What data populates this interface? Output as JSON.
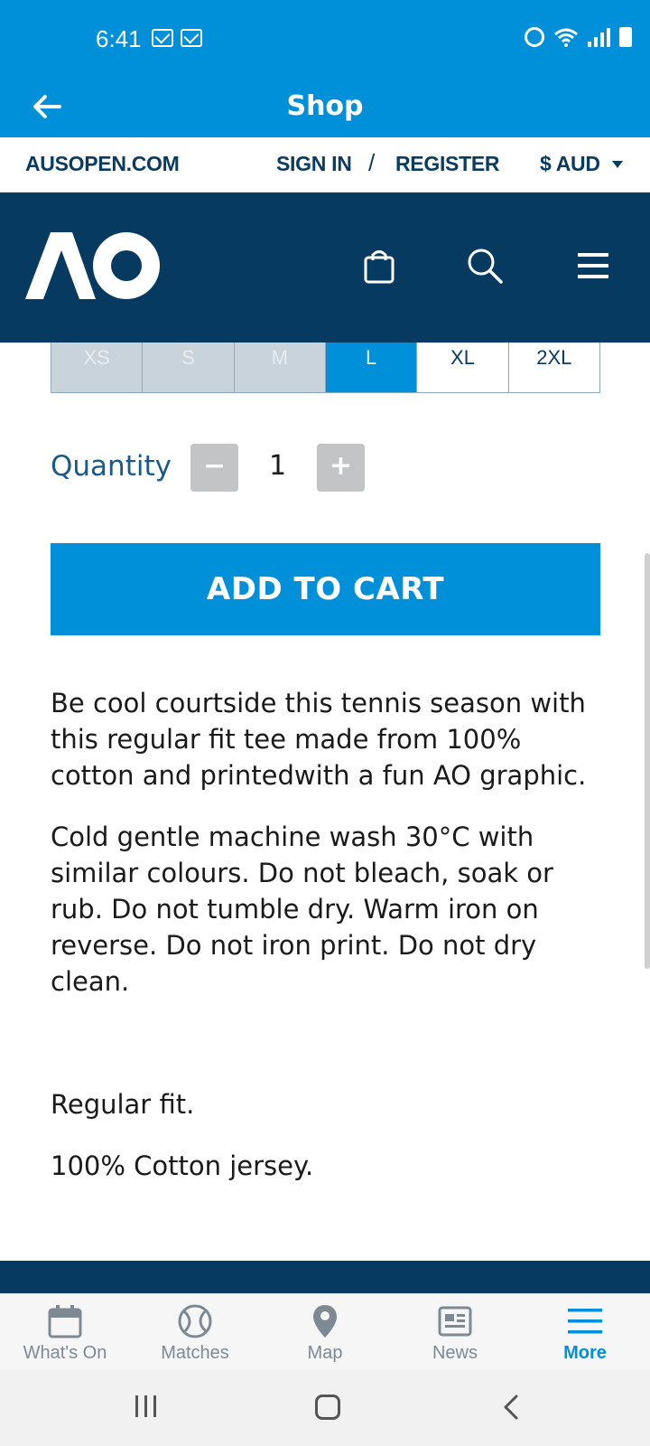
{
  "status_bar": {
    "time": "6:41"
  },
  "header": {
    "title": "Shop"
  },
  "top_links": {
    "site": "AUSOPEN.COM",
    "sign_in": "SIGN IN",
    "divider": "/",
    "register": "REGISTER",
    "currency": "$ AUD"
  },
  "sizes": [
    {
      "label": "XS",
      "state": "unavailable"
    },
    {
      "label": "S",
      "state": "unavailable"
    },
    {
      "label": "M",
      "state": "unavailable"
    },
    {
      "label": "L",
      "state": "selected"
    },
    {
      "label": "XL",
      "state": "available"
    },
    {
      "label": "2XL",
      "state": "available"
    }
  ],
  "quantity": {
    "label": "Quantity",
    "value": "1",
    "minus": "−",
    "plus": "+"
  },
  "add_to_cart": "ADD TO CART",
  "description": {
    "p1": "Be cool courtside this tennis season with this regular fit tee made from 100% cotton and printedwith a fun AO graphic.",
    "p2": "Cold gentle machine wash 30°C with similar colours. Do not bleach, soak or rub. Do not tumble dry. Warm iron on reverse. Do not iron print. Do not dry clean.",
    "p3": "Regular fit.",
    "p4": "100% Cotton jersey."
  },
  "bottom_nav": [
    {
      "label": "What's On",
      "icon": "calendar-icon",
      "active": false
    },
    {
      "label": "Matches",
      "icon": "tennis-ball-icon",
      "active": false
    },
    {
      "label": "Map",
      "icon": "map-pin-icon",
      "active": false
    },
    {
      "label": "News",
      "icon": "news-icon",
      "active": false
    },
    {
      "label": "More",
      "icon": "hamburger-icon",
      "active": true
    }
  ],
  "colors": {
    "brand_blue": "#0090d9",
    "navy": "#063a60",
    "inactive_nav": "#7d8a94"
  }
}
